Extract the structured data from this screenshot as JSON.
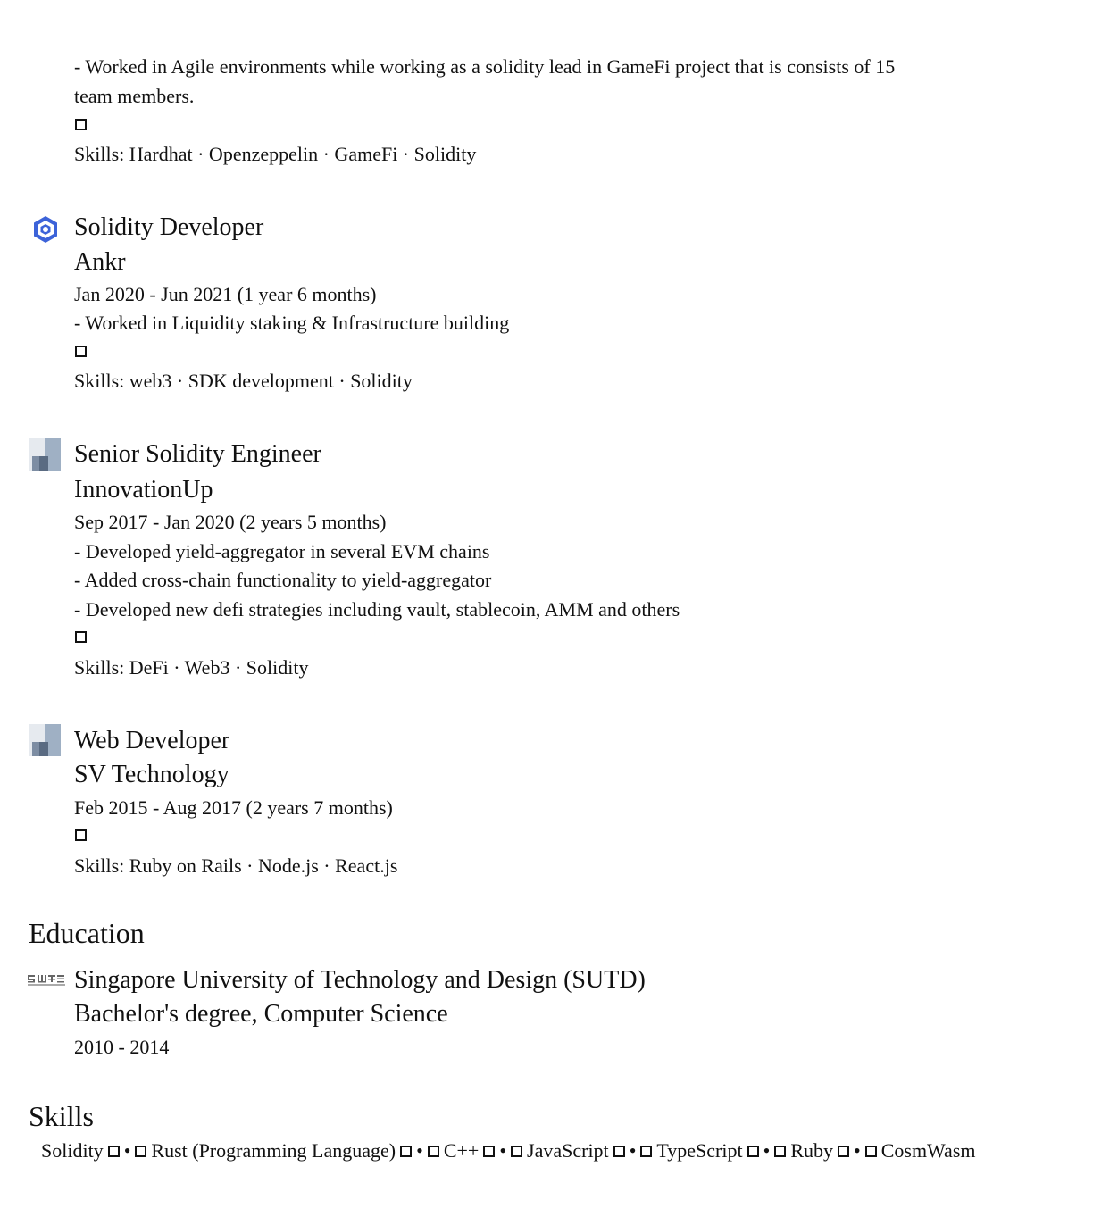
{
  "lead_job": {
    "desc_line1": "- Worked in Agile environments while working as a solidity lead in GameFi project that is consists of 15",
    "desc_line2": "team members.",
    "skills": "Skills: Hardhat · Openzeppelin · GameFi · Solidity"
  },
  "experience": [
    {
      "title": "Solidity Developer",
      "company": "Ankr",
      "dates": "Jan 2020 - Jun 2021 (1 year 6 months)",
      "bullets": [
        "- Worked in Liquidity staking & Infrastructure building"
      ],
      "skills": "Skills: web3 · SDK development · Solidity",
      "logo_icon": "ankr-logo-icon"
    },
    {
      "title": "Senior Solidity Engineer",
      "company": "InnovationUp",
      "dates": "Sep 2017 - Jan 2020 (2 years 5 months)",
      "bullets": [
        "- Developed yield-aggregator in several EVM chains",
        "- Added cross-chain functionality to yield-aggregator",
        "- Developed new defi strategies including vault, stablecoin, AMM and others"
      ],
      "skills": "Skills: DeFi · Web3 · Solidity",
      "logo_icon": "company-placeholder-icon"
    },
    {
      "title": "Web Developer",
      "company": "SV Technology",
      "dates": "Feb 2015 - Aug 2017 (2 years 7 months)",
      "bullets": [],
      "skills": "Skills: Ruby on Rails · Node.js · React.js",
      "logo_icon": "company-placeholder-icon"
    }
  ],
  "education": {
    "heading": "Education",
    "school": "Singapore University of Technology and Design (SUTD)",
    "degree": "Bachelor's degree, Computer Science",
    "years": "2010 - 2014",
    "logo_icon": "sutd-logo-icon"
  },
  "skills_section": {
    "heading": "Skills",
    "items": [
      "Solidity",
      "Rust (Programming Language)",
      "C++",
      "JavaScript",
      "TypeScript",
      "Ruby",
      "CosmWasm"
    ],
    "separator": "•"
  },
  "colors": {
    "ankr_blue": "#3c63d9",
    "placeholder_light": "#c9d2dd",
    "placeholder_dark": "#5a6b82"
  }
}
